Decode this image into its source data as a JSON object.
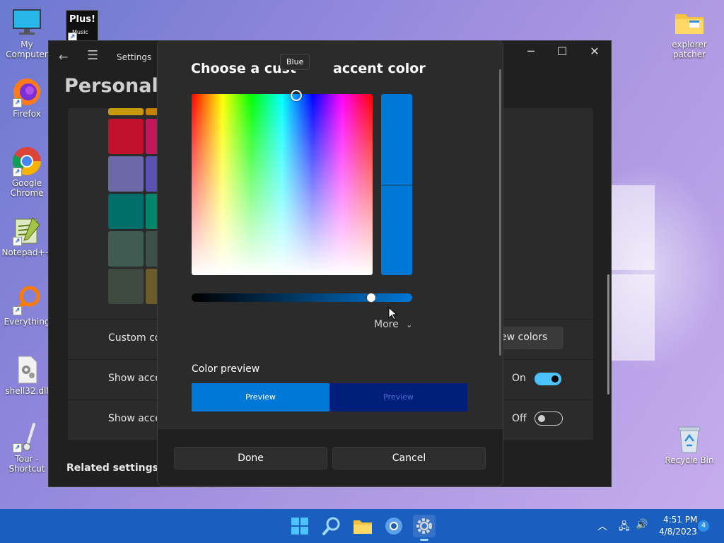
{
  "desktop": {
    "icons": [
      {
        "label": "My Computer",
        "icon": "computer-icon"
      },
      {
        "label": "Plus! Music",
        "icon": "plus-music-icon"
      },
      {
        "label": "Firefox",
        "icon": "firefox-icon"
      },
      {
        "label": "Google Chrome",
        "icon": "chrome-icon"
      },
      {
        "label": "Notepad++",
        "icon": "notepadpp-icon"
      },
      {
        "label": "Everything",
        "icon": "everything-icon"
      },
      {
        "label": "shell32.dll",
        "icon": "dll-file-icon"
      },
      {
        "label": "Tour - Shortcut",
        "icon": "tour-icon"
      },
      {
        "label": "explorer patcher",
        "icon": "folder-icon"
      },
      {
        "label": "Recycle Bin",
        "icon": "recycle-bin-icon"
      }
    ],
    "plus_music_text": "Plus!",
    "plus_music_sub": "Music"
  },
  "settings": {
    "title": "Settings",
    "heading": "Personaliza",
    "rows": [
      {
        "label": "Custom col",
        "button": "ew colors"
      },
      {
        "label": "Show accen",
        "state": "On"
      },
      {
        "label": "Show accen",
        "state": "Off"
      }
    ],
    "related": "Related settings"
  },
  "dialog": {
    "title_part1": "Choose a cust",
    "title_part2": "accent color",
    "tooltip": "Blue",
    "more_label": "More",
    "preview_label": "Color preview",
    "preview_light": "Preview",
    "preview_dark": "Preview",
    "done_label": "Done",
    "cancel_label": "Cancel",
    "selected_color": "#0078D7",
    "preview_dark_color": "#001E7A",
    "value_slider_fraction": 0.81
  },
  "taskbar": {
    "time": "4:51 PM",
    "date": "4/8/2023",
    "notifications": "4"
  }
}
